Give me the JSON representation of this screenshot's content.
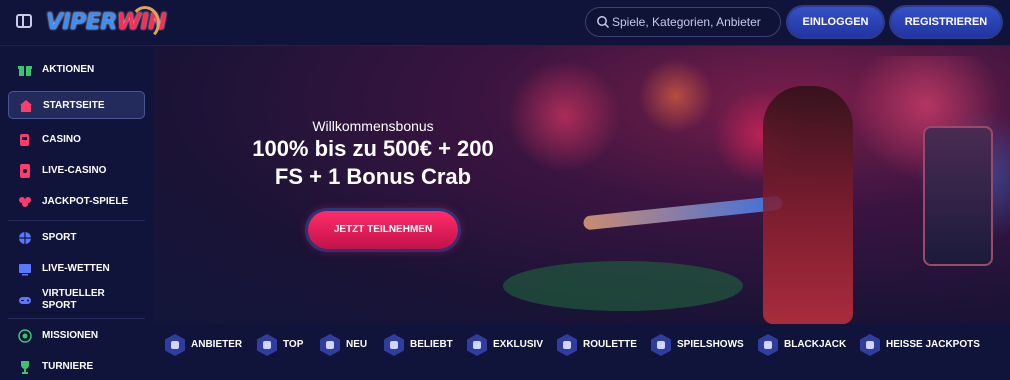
{
  "header": {
    "logo_part1": "VIPER",
    "logo_part2": "WIN",
    "search_placeholder": "Spiele, Kategorien, Anbieter",
    "login_label": "EINLOGGEN",
    "register_label": "REGISTRIEREN"
  },
  "sidebar": {
    "items": [
      {
        "label": "AKTIONEN",
        "icon": "gift-icon"
      },
      {
        "label": "STARTSEITE",
        "icon": "home-icon",
        "active": true
      },
      {
        "label": "CASINO",
        "icon": "slot-machine-icon"
      },
      {
        "label": "LIVE-CASINO",
        "icon": "live-cards-icon"
      },
      {
        "label": "JACKPOT-SPIELE",
        "icon": "clover-icon"
      },
      {
        "label": "SPORT",
        "icon": "ball-icon"
      },
      {
        "label": "LIVE-WETTEN",
        "icon": "tv-icon"
      },
      {
        "label": "VIRTUELLER SPORT",
        "icon": "gamepad-icon"
      },
      {
        "label": "MISSIONEN",
        "icon": "target-icon"
      },
      {
        "label": "TURNIERE",
        "icon": "trophy-icon"
      }
    ]
  },
  "banner": {
    "subtitle": "Willkommensbonus",
    "title_line1": "100% bis zu 500€ + 200",
    "title_line2": "FS + 1 Bonus Crab",
    "cta_label": "JETZT TEILNEHMEN"
  },
  "categories": [
    {
      "label": "ANBIETER",
      "icon": "provider-icon"
    },
    {
      "label": "TOP",
      "icon": "star-icon"
    },
    {
      "label": "NEU",
      "icon": "new-icon"
    },
    {
      "label": "BELIEBT",
      "icon": "flame-icon"
    },
    {
      "label": "EXKLUSIV",
      "icon": "diamond-icon"
    },
    {
      "label": "ROULETTE",
      "icon": "roulette-icon"
    },
    {
      "label": "SPIELSHOWS",
      "icon": "show-icon"
    },
    {
      "label": "BLACKJACK",
      "icon": "spade-icon"
    },
    {
      "label": "HEISSE JACKPOTS",
      "icon": "jackpot-icon"
    }
  ],
  "colors": {
    "background": "#0d1033",
    "accent_blue": "#2e45b8",
    "accent_pink": "#ff2d6a",
    "icon_green": "#3ac46e",
    "icon_pink": "#ff3b6b",
    "icon_blue": "#5a78ff"
  }
}
